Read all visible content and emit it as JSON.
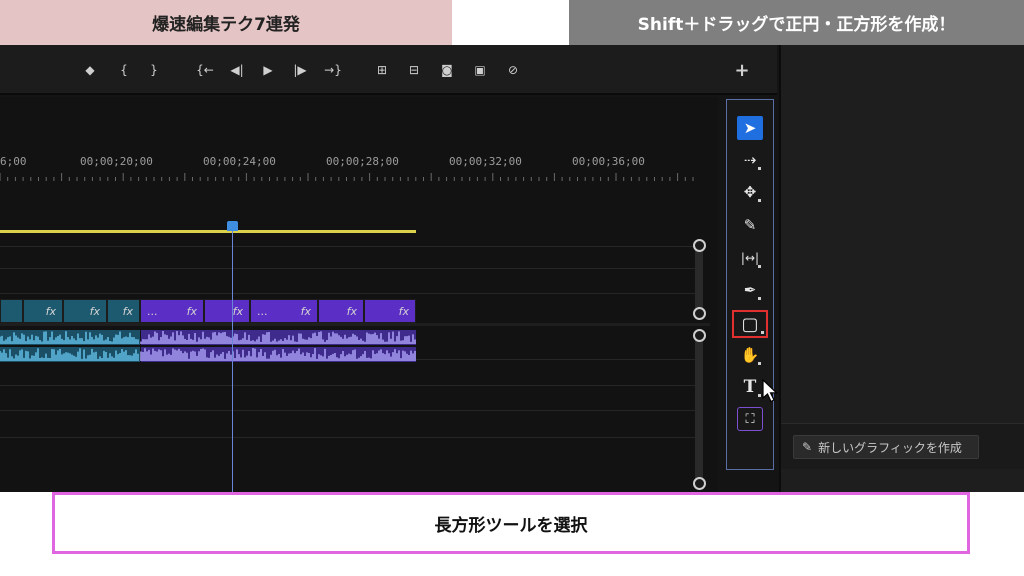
{
  "banners": {
    "left": "爆速編集テク7連発",
    "right": "Shift＋ドラッグで正円・正方形を作成！"
  },
  "transport": {
    "buttons": [
      {
        "name": "add-marker-icon",
        "glyph": "◆"
      },
      {
        "name": "mark-in-icon",
        "glyph": "{"
      },
      {
        "name": "mark-out-icon",
        "glyph": "}"
      },
      {
        "name": "go-to-in-icon",
        "glyph": "{←"
      },
      {
        "name": "step-back-icon",
        "glyph": "◀|"
      },
      {
        "name": "play-icon",
        "glyph": "▶"
      },
      {
        "name": "step-forward-icon",
        "glyph": "|▶"
      },
      {
        "name": "go-to-out-icon",
        "glyph": "→}"
      },
      {
        "name": "lift-icon",
        "glyph": "⊞"
      },
      {
        "name": "extract-icon",
        "glyph": "⊟"
      },
      {
        "name": "export-frame-icon",
        "glyph": "◙"
      },
      {
        "name": "comparison-view-icon",
        "glyph": "▣"
      },
      {
        "name": "proxy-toggle-icon",
        "glyph": "⊘"
      }
    ],
    "add_glyph": "+"
  },
  "ruler": {
    "labels": [
      "6;00",
      "00;00;20;00",
      "00;00;24;00",
      "00;00;28;00",
      "00;00;32;00",
      "00;00;36;00"
    ]
  },
  "clips": {
    "fx_label": "fx",
    "dots_label": "..."
  },
  "tools": {
    "items": [
      {
        "name": "selection-tool-icon",
        "glyph": "➤"
      },
      {
        "name": "track-select-tool-icon",
        "glyph": "⇢"
      },
      {
        "name": "ripple-edit-tool-icon",
        "glyph": "✥"
      },
      {
        "name": "razor-tool-icon",
        "glyph": "✎"
      },
      {
        "name": "slip-tool-icon",
        "glyph": "|↔|"
      },
      {
        "name": "pen-tool-icon",
        "glyph": "✒"
      },
      {
        "name": "rectangle-tool-icon",
        "glyph": "▢"
      },
      {
        "name": "hand-tool-icon",
        "glyph": "✋"
      },
      {
        "name": "type-tool-icon",
        "glyph": "T"
      },
      {
        "name": "auto-reframe-icon",
        "glyph": "⛶"
      }
    ]
  },
  "right_panel": {
    "new_graphic_label": "新しいグラフィックを作成"
  },
  "caption": {
    "text": "長方形ツールを選択"
  },
  "colors": {
    "accent": "#1f6fe0",
    "highlight": "#e23030",
    "caption_border": "#e065e0"
  }
}
